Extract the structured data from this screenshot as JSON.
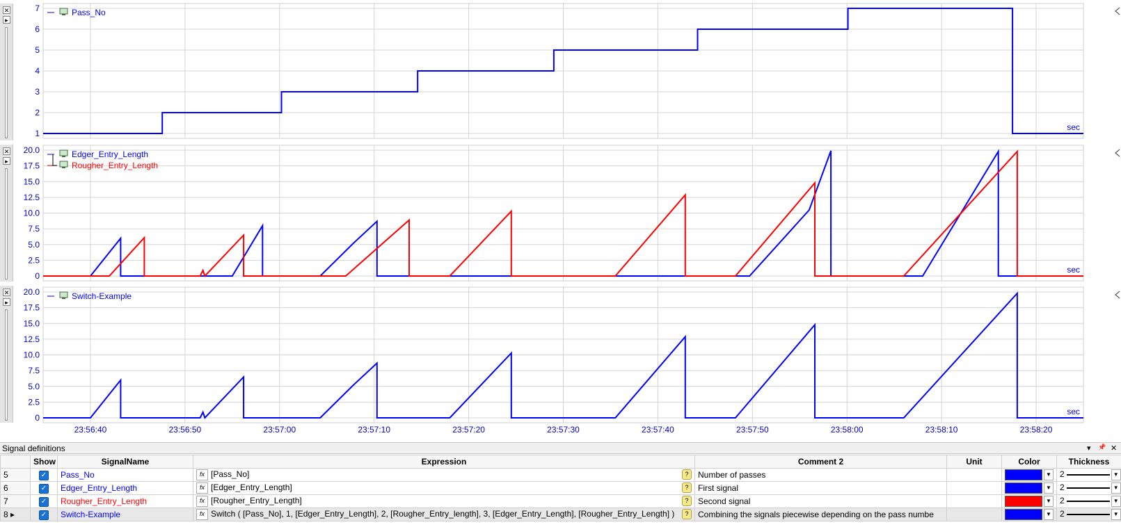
{
  "colors": {
    "blue": "#0000ff",
    "red": "#ff0000",
    "grid": "#d4d4d4"
  },
  "unit_label": "sec",
  "x_axis": {
    "start": "23:56:35",
    "end": "23:58:25",
    "ticks": [
      "23:56:40",
      "23:56:50",
      "23:57:00",
      "23:57:10",
      "23:57:20",
      "23:57:30",
      "23:57:40",
      "23:57:50",
      "23:58:00",
      "23:58:10",
      "23:58:20"
    ]
  },
  "chart_data": [
    {
      "type": "line",
      "ylim": [
        1,
        7
      ],
      "yticks": [
        "1",
        "2",
        "3",
        "4",
        "5",
        "6",
        "7"
      ],
      "series": [
        {
          "name": "Pass_No",
          "color": "#0000ff",
          "points": [
            [
              0,
              1
            ],
            [
              12.6,
              1
            ],
            [
              12.6,
              2
            ],
            [
              25.2,
              2
            ],
            [
              25.2,
              3
            ],
            [
              39.6,
              3
            ],
            [
              39.6,
              4
            ],
            [
              54.0,
              4
            ],
            [
              54.0,
              5
            ],
            [
              69.2,
              5
            ],
            [
              69.2,
              6
            ],
            [
              85.1,
              6
            ],
            [
              85.1,
              7
            ],
            [
              102.5,
              7
            ],
            [
              102.5,
              1
            ],
            [
              110,
              1
            ]
          ]
        }
      ]
    },
    {
      "type": "line",
      "ylim": [
        0,
        20
      ],
      "yticks": [
        "0",
        "2.5",
        "5.0",
        "7.5",
        "10.0",
        "12.5",
        "15.0",
        "17.5",
        "20.0"
      ],
      "series": [
        {
          "name": "Edger_Entry_Length",
          "color": "#0000ff",
          "points": [
            [
              0,
              0
            ],
            [
              5.0,
              0
            ],
            [
              6.7,
              3.2
            ],
            [
              8.2,
              6.0
            ],
            [
              8.2,
              0
            ],
            [
              19.1,
              0
            ],
            [
              20.0,
              0
            ],
            [
              23.2,
              8.0
            ],
            [
              23.2,
              0
            ],
            [
              29.3,
              0
            ],
            [
              32.8,
              5.2
            ],
            [
              35.3,
              8.7
            ],
            [
              35.3,
              0
            ],
            [
              49.5,
              0
            ],
            [
              54.0,
              0
            ],
            [
              66.3,
              0
            ],
            [
              69.2,
              0
            ],
            [
              74.7,
              0
            ],
            [
              81.0,
              10.5
            ],
            [
              83.3,
              19.9
            ],
            [
              83.3,
              0
            ],
            [
              93.0,
              0
            ],
            [
              101.0,
              19.8
            ],
            [
              101.0,
              0
            ],
            [
              102.0,
              0
            ],
            [
              110,
              0
            ]
          ]
        },
        {
          "name": "Rougher_Entry_Length",
          "color": "#ff0000",
          "points": [
            [
              0,
              0
            ],
            [
              7.0,
              0
            ],
            [
              10.7,
              6.1
            ],
            [
              10.7,
              0
            ],
            [
              16.6,
              0
            ],
            [
              16.9,
              0.9
            ],
            [
              17.1,
              0
            ],
            [
              21.2,
              6.5
            ],
            [
              21.2,
              0
            ],
            [
              32.0,
              0
            ],
            [
              38.7,
              8.9
            ],
            [
              38.7,
              0
            ],
            [
              43.0,
              0
            ],
            [
              49.5,
              10.3
            ],
            [
              49.5,
              0
            ],
            [
              60.5,
              0
            ],
            [
              67.9,
              12.9
            ],
            [
              67.9,
              0
            ],
            [
              73.2,
              0
            ],
            [
              81.6,
              14.8
            ],
            [
              81.6,
              0
            ],
            [
              91.0,
              0
            ],
            [
              103.0,
              19.8
            ],
            [
              103.0,
              0
            ],
            [
              110,
              0
            ]
          ]
        }
      ]
    },
    {
      "type": "line",
      "ylim": [
        0,
        20
      ],
      "yticks": [
        "0",
        "2.5",
        "5.0",
        "7.5",
        "10.0",
        "12.5",
        "15.0",
        "17.5",
        "20.0"
      ],
      "series": [
        {
          "name": "Switch-Example",
          "color": "#0000ff",
          "points": [
            [
              0,
              0
            ],
            [
              5.0,
              0
            ],
            [
              6.7,
              3.2
            ],
            [
              8.2,
              6.0
            ],
            [
              8.2,
              0
            ],
            [
              16.6,
              0
            ],
            [
              16.9,
              0.9
            ],
            [
              17.1,
              0
            ],
            [
              21.2,
              6.5
            ],
            [
              21.2,
              0
            ],
            [
              29.3,
              0
            ],
            [
              32.8,
              5.2
            ],
            [
              35.3,
              8.7
            ],
            [
              35.3,
              0
            ],
            [
              43.0,
              0
            ],
            [
              49.5,
              10.3
            ],
            [
              49.5,
              0
            ],
            [
              60.5,
              0
            ],
            [
              67.9,
              12.9
            ],
            [
              67.9,
              0
            ],
            [
              73.2,
              0
            ],
            [
              81.6,
              14.8
            ],
            [
              81.6,
              0
            ],
            [
              91.0,
              0
            ],
            [
              103.0,
              19.8
            ],
            [
              103.0,
              0
            ],
            [
              110,
              0
            ]
          ]
        }
      ]
    }
  ],
  "signal_panel": {
    "title": "Signal definitions",
    "controls": [
      "▾",
      "📌",
      "✕"
    ],
    "columns": [
      "",
      "Show",
      "SignalName",
      "Expression",
      "Comment 2",
      "Unit",
      "Color",
      "Thickness"
    ],
    "rows": [
      {
        "num": "5",
        "name": "Pass_No",
        "name_color": "#0000ff",
        "expression": "[Pass_No]",
        "comment": "Number of passes",
        "unit": "",
        "color": "#0000ff",
        "thickness": "2"
      },
      {
        "num": "6",
        "name": "Edger_Entry_Length",
        "name_color": "#0000ff",
        "expression": "[Edger_Entry_Length]",
        "comment": "First signal",
        "unit": "",
        "color": "#0000ff",
        "thickness": "2"
      },
      {
        "num": "7",
        "name": "Rougher_Entry_Length",
        "name_color": "#ff0000",
        "expression": "[Rougher_Entry_Length]",
        "comment": "Second signal",
        "unit": "",
        "color": "#ff0000",
        "thickness": "2"
      },
      {
        "num": "8 ▸",
        "name": "Switch-Example",
        "name_color": "#0000ff",
        "expression": "Switch ( [Pass_No], 1, [Edger_Entry_Length], 2, [Rougher_Entry_length], 3, [Edger_Entry_Length], [Rougher_Entry_Length] )",
        "comment": "Combining the signals piecewise depending on the pass numbe",
        "unit": "",
        "color": "#0000ff",
        "thickness": "2"
      }
    ]
  }
}
